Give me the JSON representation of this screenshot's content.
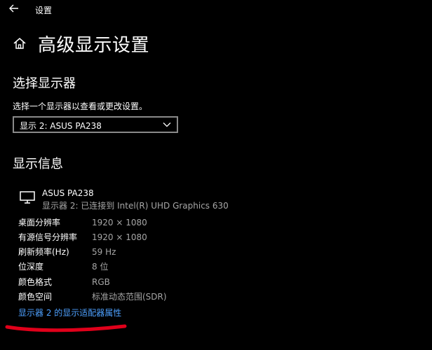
{
  "window": {
    "title": "设置",
    "back_icon": "back-arrow-icon"
  },
  "page": {
    "title": "高级显示设置",
    "home_icon": "home-icon"
  },
  "select_display": {
    "heading": "选择显示器",
    "description": "选择一个显示器以查看或更改设置。",
    "dropdown_value": "显示 2: ASUS PA238"
  },
  "display_info": {
    "heading": "显示信息",
    "monitor_name": "ASUS PA238",
    "monitor_connection": "显示器 2: 已连接到 Intel(R) UHD Graphics 630",
    "rows": [
      {
        "label": "桌面分辨率",
        "value": "1920 × 1080"
      },
      {
        "label": "有源信号分辨率",
        "value": "1920 × 1080"
      },
      {
        "label": "刷新频率(Hz)",
        "value": "59 Hz"
      },
      {
        "label": "位深度",
        "value": "8 位"
      },
      {
        "label": "颜色格式",
        "value": "RGB"
      },
      {
        "label": "颜色空间",
        "value": "标准动态范围(SDR)"
      }
    ],
    "adapter_link": "显示器 2 的显示适配器属性"
  },
  "colors": {
    "link": "#4ea1ff",
    "secondary_text": "#a6a6a6",
    "annotation": "#e0001a"
  }
}
